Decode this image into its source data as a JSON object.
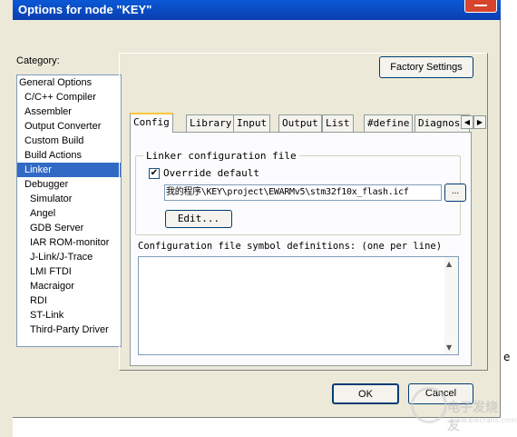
{
  "window": {
    "title": "Options for node \"KEY\""
  },
  "category": {
    "label": "Category:",
    "items": [
      {
        "label": "General Options",
        "level": 0
      },
      {
        "label": "C/C++ Compiler",
        "level": 1
      },
      {
        "label": "Assembler",
        "level": 1
      },
      {
        "label": "Output Converter",
        "level": 1
      },
      {
        "label": "Custom Build",
        "level": 1
      },
      {
        "label": "Build Actions",
        "level": 1
      },
      {
        "label": "Linker",
        "level": 1,
        "selected": true
      },
      {
        "label": "Debugger",
        "level": 1
      },
      {
        "label": "Simulator",
        "level": 2
      },
      {
        "label": "Angel",
        "level": 2
      },
      {
        "label": "GDB Server",
        "level": 2
      },
      {
        "label": "IAR ROM-monitor",
        "level": 2
      },
      {
        "label": "J-Link/J-Trace",
        "level": 2
      },
      {
        "label": "LMI FTDI",
        "level": 2
      },
      {
        "label": "Macraigor",
        "level": 2
      },
      {
        "label": "RDI",
        "level": 2
      },
      {
        "label": "ST-Link",
        "level": 2
      },
      {
        "label": "Third-Party Driver",
        "level": 2
      }
    ]
  },
  "buttons": {
    "factory": "Factory Settings",
    "browse": "...",
    "edit": "Edit...",
    "ok": "OK",
    "cancel": "Cancel"
  },
  "tabs": [
    "Config",
    "Library",
    "Input",
    "Output",
    "List",
    "#define",
    "Diagnost"
  ],
  "linker": {
    "group_label": "Linker configuration file",
    "override_label": "Override default",
    "override_checked": true,
    "config_path": "我的程序\\KEY\\project\\EWARMv5\\stm32f10x_flash.icf",
    "defs_label": "Configuration file symbol definitions: (one per line)",
    "defs_value": ""
  },
  "background": {
    "right_edge_letter": "e"
  },
  "watermark": {
    "text": "电子发烧友",
    "url": "www.elecfans.com"
  },
  "colors": {
    "title_bar": "#0a4fc8",
    "selection": "#316ac5",
    "dialog_bg": "#ece9d8"
  }
}
